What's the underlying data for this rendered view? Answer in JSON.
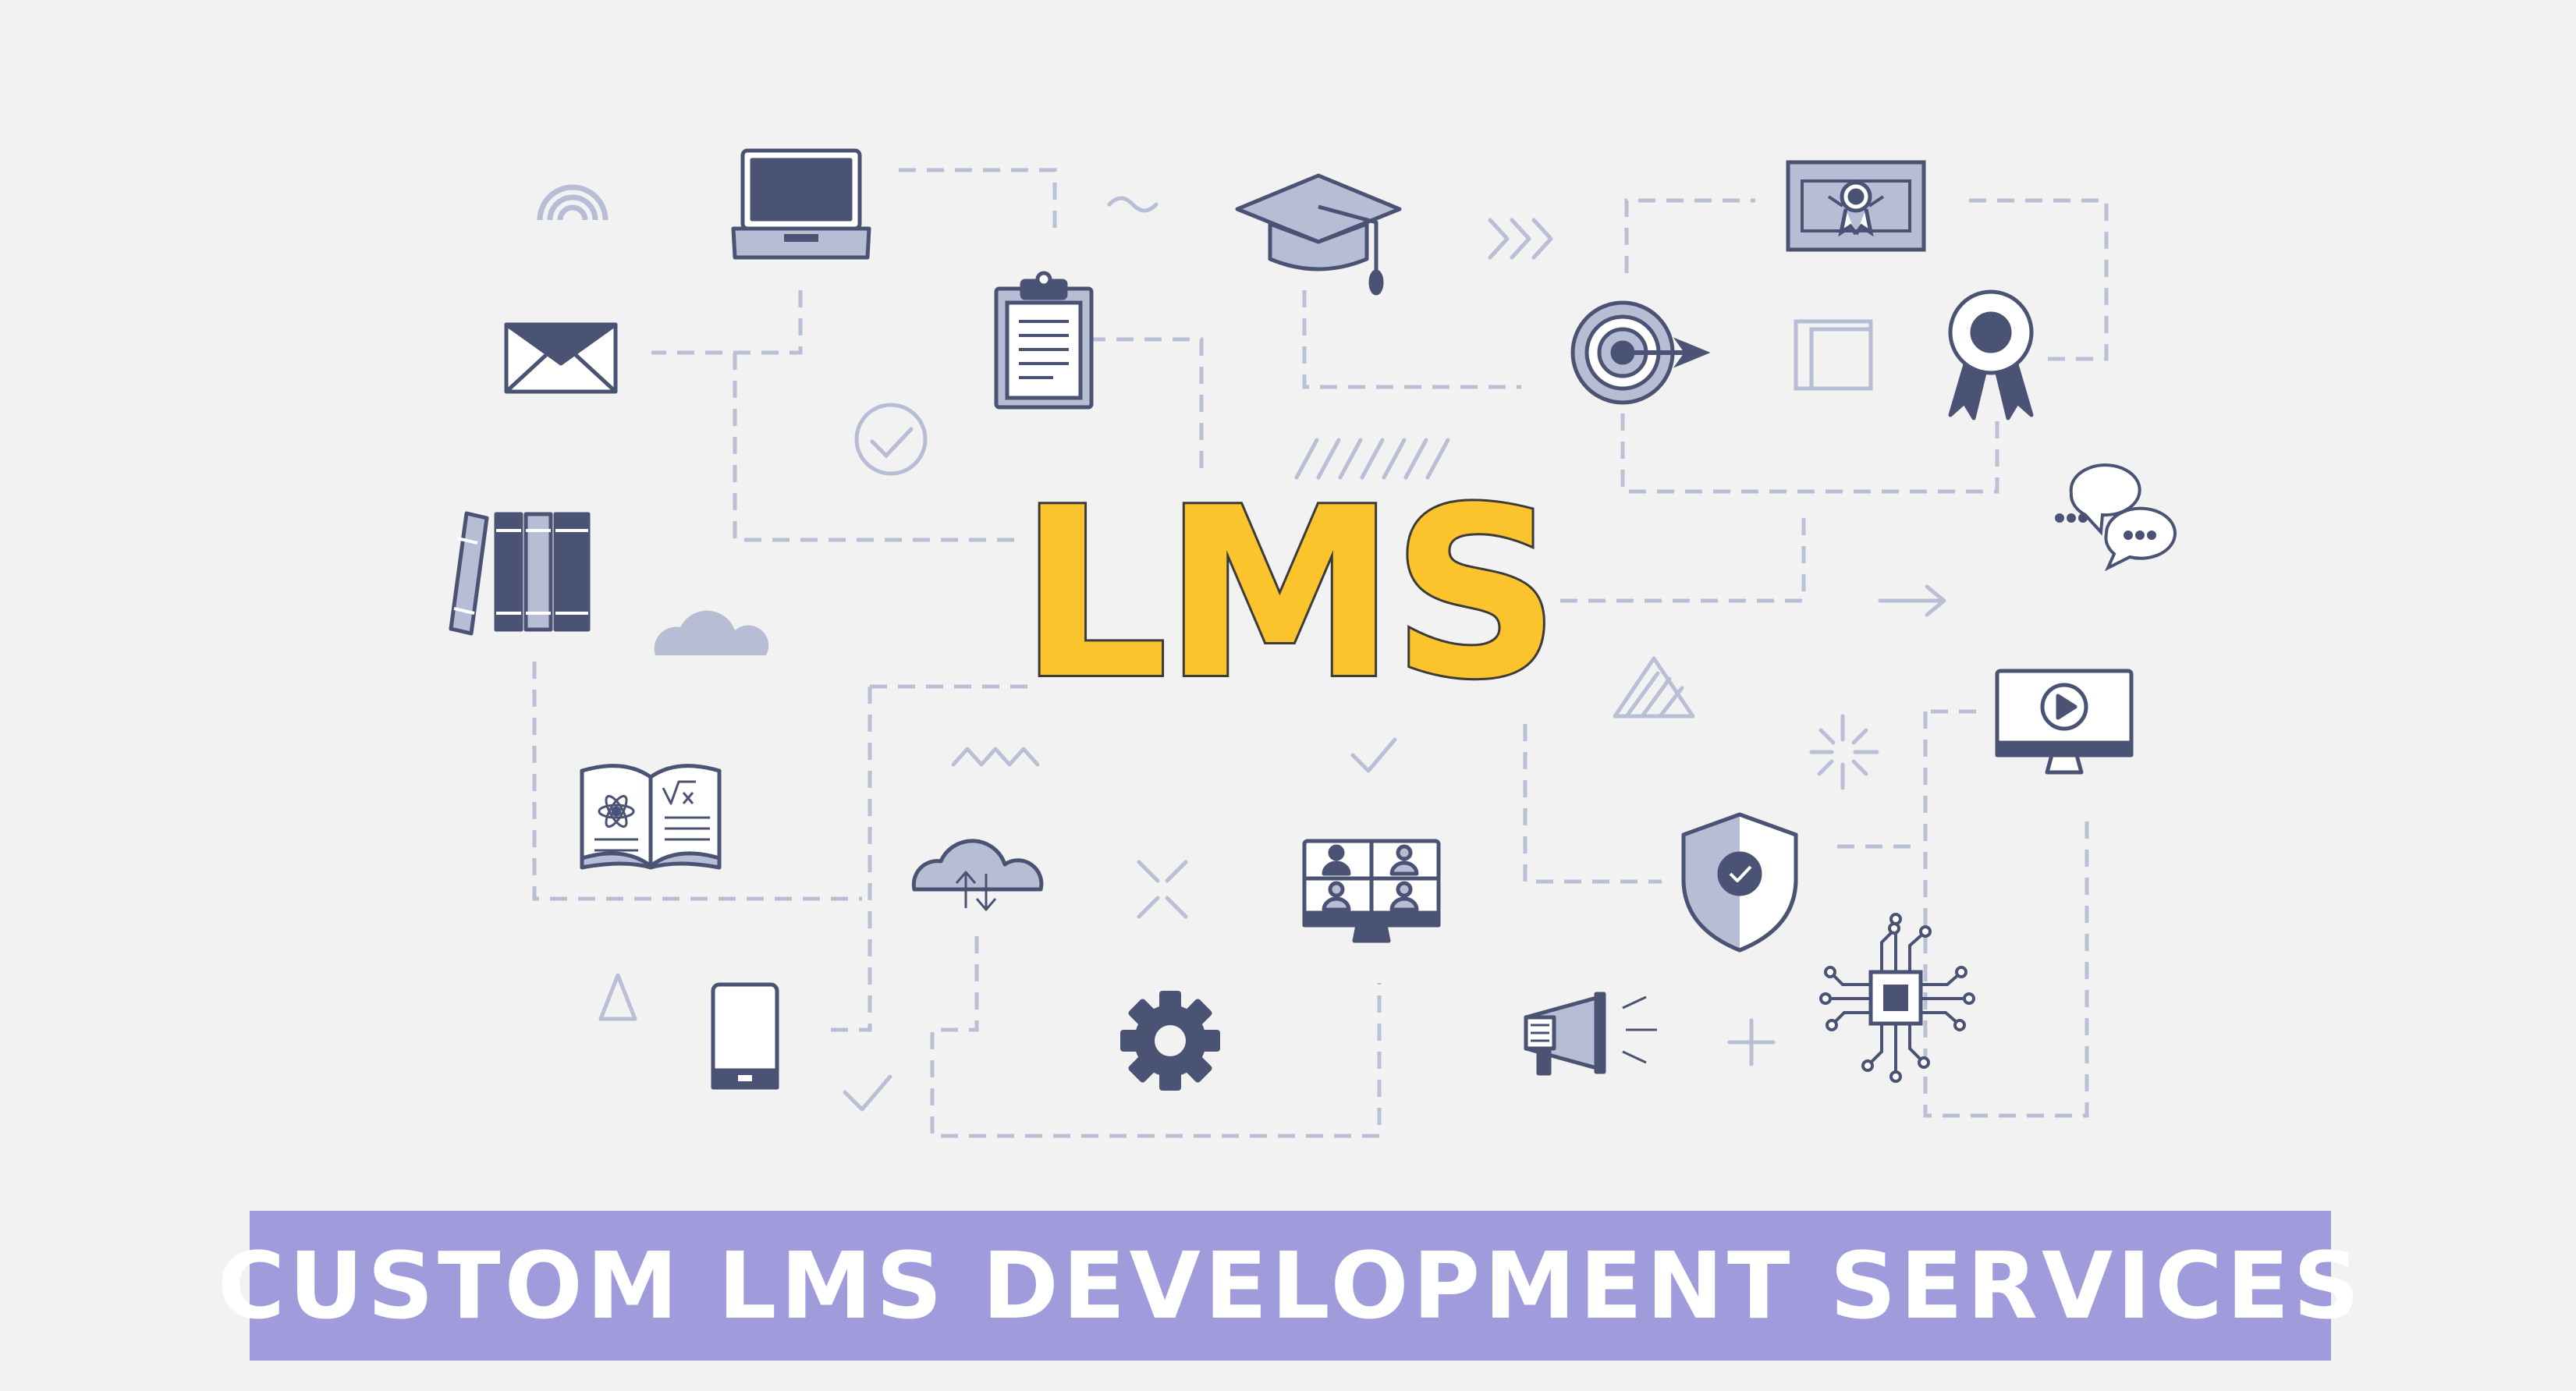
{
  "headline": "LMS",
  "banner": {
    "text": "CUSTOM LMS DEVELOPMENT SERVICES"
  },
  "colors": {
    "background": "#f2f2f2",
    "icon_dark": "#4a5373",
    "icon_light": "#b7bdd4",
    "connector": "#b9bfd4",
    "headline_fill": "#fbc42c",
    "headline_outline": "#3b3b3b",
    "banner_background": "#a09bdb",
    "banner_text": "#ffffff"
  },
  "icons": [
    "wifi-signal-icon",
    "laptop-icon",
    "graduation-cap-icon",
    "certificate-icon",
    "envelope-icon",
    "clipboard-icon",
    "target-icon",
    "award-ribbon-icon",
    "checkmark-circle-icon",
    "books-icon",
    "cloud-icon",
    "chat-bubbles-icon",
    "open-book-icon",
    "cloud-sync-icon",
    "video-conference-icon",
    "security-shield-icon",
    "video-monitor-icon",
    "smartphone-icon",
    "gear-icon",
    "megaphone-icon",
    "cpu-chip-icon"
  ]
}
